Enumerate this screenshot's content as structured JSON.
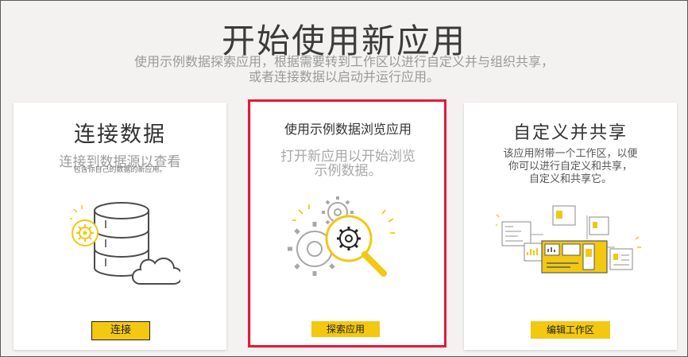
{
  "header": {
    "title": "开始使用新应用",
    "subtitle_line1": "使用示例数据探索应用，根据需要转到工作区以进行自定义并与组织共享，",
    "subtitle_line2": "或者连接数据以启动并运行应用。"
  },
  "cards": [
    {
      "title": "连接数据",
      "desc_line1": "连接到数据源以查看",
      "desc_line2": "包含你自己的数据的新应用。",
      "button": "连接",
      "illustration": "database-gear-cloud-icon"
    },
    {
      "title": "使用示例数据浏览应用",
      "desc_line1": "打开新应用以开始浏览",
      "desc_line2": "示例数据。",
      "button": "探索应用",
      "illustration": "gears-magnifier-icon"
    },
    {
      "title": "自定义并共享",
      "desc_line1": "该应用附带一个工作区，以便",
      "desc_line2": "你可以进行自定义和共享，",
      "desc_line3": "自定义和共享它。",
      "button": "编辑工作区",
      "illustration": "workspace-dashboard-icon"
    }
  ],
  "colors": {
    "accent": "#f2c811",
    "highlight": "#e8183a",
    "background": "#f3f2f1"
  }
}
